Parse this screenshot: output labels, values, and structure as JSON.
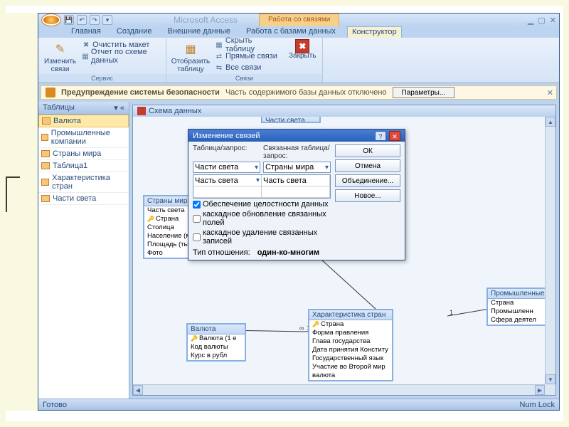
{
  "app_title": "Microsoft Access",
  "contextual_tab": "Работа со связями",
  "tabs": [
    "Главная",
    "Создание",
    "Внешние данные",
    "Работа с базами данных",
    "Конструктор"
  ],
  "active_tab": 4,
  "ribbon": {
    "group1_label": "Сервис",
    "edit_rel": "Изменить\nсвязи",
    "clear_layout": "Очистить макет",
    "rel_report": "Отчет по схеме данных",
    "group2_label": "Связи",
    "show_table": "Отобразить\nтаблицу",
    "hide_table": "Скрыть таблицу",
    "direct_rel": "Прямые связи",
    "all_rel": "Все связи",
    "close": "Закрыть"
  },
  "security": {
    "bold": "Предупреждение системы безопасности",
    "msg": "Часть содержимого базы данных отключено",
    "btn": "Параметры..."
  },
  "nav_head": "Таблицы",
  "nav_items": [
    "Валюта",
    "Промышленные компании",
    "Страны мира",
    "Таблица1",
    "Характеристика стран",
    "Части света"
  ],
  "doc_title": "Схема данных",
  "tables": {
    "strany": {
      "title": "Страны мира",
      "fields": [
        "Часть света",
        "Страна",
        "Столица",
        "Население (млн",
        "Площадь (тыс км",
        "Фото"
      ],
      "key": 1
    },
    "valuta": {
      "title": "Валюта",
      "fields": [
        "Валюта (1 е",
        "Код валюты",
        "Курс в рубл"
      ],
      "key": 0
    },
    "har": {
      "title": "Характеристика стран",
      "fields": [
        "Страна",
        "Форма правления",
        "Глава государства",
        "Дата принятия Конститу",
        "Государственный язык",
        "Участие во Второй мир",
        "валюта"
      ],
      "key": 0
    },
    "chasti_partial": {
      "title": "Части света"
    },
    "prom": {
      "title": "Промышленные",
      "fields": [
        "Страна",
        "Промышленн",
        "Сфера деятел"
      ]
    }
  },
  "dialog": {
    "title": "Изменение связей",
    "left_label": "Таблица/запрос:",
    "right_label": "Связанная таблица/запрос:",
    "left_table": "Части света",
    "right_table": "Страны мира",
    "left_field": "Часть света",
    "right_field": "Часть света",
    "chk1": "Обеспечение целостности данных",
    "chk2": "каскадное обновление связанных полей",
    "chk3": "каскадное удаление связанных записей",
    "reltype_label": "Тип отношения:",
    "reltype_value": "один-ко-многим",
    "btn_ok": "ОК",
    "btn_cancel": "Отмена",
    "btn_join": "Объединение...",
    "btn_new": "Новое..."
  },
  "status_left": "Готово",
  "status_right": "Num Lock"
}
